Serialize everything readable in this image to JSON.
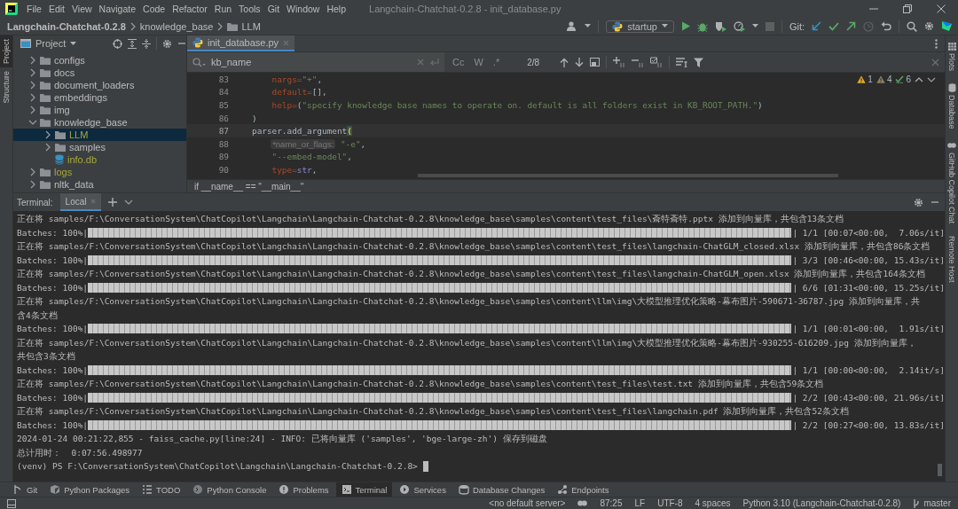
{
  "window": {
    "title": "Langchain-Chatchat-0.2.8 - init_database.py"
  },
  "menu": [
    "File",
    "Edit",
    "View",
    "Navigate",
    "Code",
    "Refactor",
    "Run",
    "Tools",
    "Git",
    "Window",
    "Help"
  ],
  "breadcrumb": [
    "Langchain-Chatchat-0.2.8",
    "knowledge_base",
    "LLM"
  ],
  "toolbar": {
    "run_config": "startup",
    "git_label": "Git:"
  },
  "left_stripe": [
    {
      "label": "Project",
      "selected": true
    },
    {
      "label": "Structure",
      "selected": false
    }
  ],
  "right_stripe": [
    "Plots",
    "Database",
    "GitHub Copilot Chat",
    "Remote Host"
  ],
  "project": {
    "title": "Project",
    "tree": [
      {
        "name": "configs",
        "kind": "folder",
        "expanded": false,
        "ignored": false,
        "selected": false
      },
      {
        "name": "docs",
        "kind": "folder",
        "expanded": false,
        "ignored": false,
        "selected": false
      },
      {
        "name": "document_loaders",
        "kind": "folder",
        "expanded": false,
        "ignored": false,
        "selected": false
      },
      {
        "name": "embeddings",
        "kind": "folder",
        "expanded": false,
        "ignored": false,
        "selected": false
      },
      {
        "name": "img",
        "kind": "folder",
        "expanded": false,
        "ignored": false,
        "selected": false
      },
      {
        "name": "knowledge_base",
        "kind": "folder",
        "expanded": true,
        "ignored": false,
        "selected": false,
        "children": [
          {
            "name": "LLM",
            "kind": "folder",
            "expanded": false,
            "ignored": true,
            "selected": true
          },
          {
            "name": "samples",
            "kind": "folder",
            "expanded": false,
            "ignored": false,
            "selected": false
          },
          {
            "name": "info.db",
            "kind": "database",
            "ignored": true,
            "selected": false
          }
        ]
      },
      {
        "name": "logs",
        "kind": "folder",
        "expanded": false,
        "ignored": true,
        "selected": false
      },
      {
        "name": "nltk_data",
        "kind": "folder",
        "expanded": false,
        "ignored": false,
        "selected": false
      }
    ]
  },
  "editor": {
    "tab": "init_database.py",
    "find": {
      "value": "kb_name",
      "options": [
        "Cc",
        "W",
        ".*"
      ],
      "count": "2/8"
    },
    "inspections": [
      {
        "kind": "error",
        "count": "1"
      },
      {
        "kind": "warning",
        "count": "4"
      },
      {
        "kind": "typo",
        "count": "6"
      }
    ],
    "lines": [
      {
        "number": "83",
        "current": false,
        "tokens": [
          {
            "text": "    nargs=",
            "kind": "param"
          },
          {
            "text": "\"+\"",
            "kind": "string"
          },
          {
            "text": ",",
            "kind": "plain"
          }
        ]
      },
      {
        "number": "84",
        "current": false,
        "tokens": [
          {
            "text": "    default=",
            "kind": "param"
          },
          {
            "text": "[],",
            "kind": "plain"
          }
        ]
      },
      {
        "number": "85",
        "current": false,
        "tokens": [
          {
            "text": "    help=",
            "kind": "param"
          },
          {
            "text": "(",
            "kind": "plain"
          },
          {
            "text": "\"specify knowledge base names to operate on. default is all folders exist in KB_ROOT_PATH.\"",
            "kind": "string"
          },
          {
            "text": ")",
            "kind": "plain"
          }
        ]
      },
      {
        "number": "86",
        "current": false,
        "tokens": [
          {
            "text": ")",
            "kind": "plain"
          }
        ]
      },
      {
        "number": "87",
        "current": true,
        "tokens": [
          {
            "text": "parser.add_argument",
            "kind": "plain"
          },
          {
            "text": "(",
            "kind": "bracket"
          }
        ]
      },
      {
        "number": "88",
        "current": false,
        "tokens": [
          {
            "text": "*name_or_flags:",
            "kind": "hint"
          },
          {
            "text": " \"-e\"",
            "kind": "string"
          },
          {
            "text": ",",
            "kind": "plain"
          }
        ]
      },
      {
        "number": "89",
        "current": false,
        "tokens": [
          {
            "text": "    \"--embed-model\"",
            "kind": "string"
          },
          {
            "text": ",",
            "kind": "plain"
          }
        ]
      },
      {
        "number": "90",
        "current": false,
        "tokens": [
          {
            "text": "    type=",
            "kind": "param"
          },
          {
            "text": "str",
            "kind": "builtin"
          },
          {
            "text": ",",
            "kind": "plain"
          }
        ]
      }
    ],
    "scope": "if __name__ == \"__main__\""
  },
  "terminal": {
    "label": "Terminal:",
    "tabs": [
      {
        "label": "Local",
        "selected": true
      }
    ],
    "lines": [
      {
        "kind": "text",
        "text": "正在将 samples/F:\\ConversationSystem\\ChatCopilot\\Langchain\\Langchain-Chatchat-0.2.8\\knowledge_base\\samples\\content\\test_files\\斊特斊特.pptx 添加到向量库，共包含13条文档"
      },
      {
        "kind": "progress",
        "label": "Batches: 100%|",
        "level": 1,
        "suffix": "| 1/1 [00:07<00:00,  7.06s/it]"
      },
      {
        "kind": "text",
        "text": "正在将 samples/F:\\ConversationSystem\\ChatCopilot\\Langchain\\Langchain-Chatchat-0.2.8\\knowledge_base\\samples\\content\\test_files\\langchain-ChatGLM_closed.xlsx 添加到向量库，共包含86条文档"
      },
      {
        "kind": "progress",
        "label": "Batches: 100%|",
        "level": 1,
        "suffix": "| 3/3 [00:46<00:00, 15.43s/it]"
      },
      {
        "kind": "text",
        "text": "正在将 samples/F:\\ConversationSystem\\ChatCopilot\\Langchain\\Langchain-Chatchat-0.2.8\\knowledge_base\\samples\\content\\test_files\\langchain-ChatGLM_open.xlsx 添加到向量库，共包含164条文档"
      },
      {
        "kind": "progress",
        "label": "Batches: 100%|",
        "level": 1,
        "suffix": "| 6/6 [01:31<00:00, 15.25s/it]"
      },
      {
        "kind": "text",
        "text": "正在将 samples/F:\\ConversationSystem\\ChatCopilot\\Langchain\\Langchain-Chatchat-0.2.8\\knowledge_base\\samples\\content\\llm\\img\\大模型推理优化策略-幕布图片-590671-36787.jpg 添加到向量库，共"
      },
      {
        "kind": "text",
        "text": "含4条文档"
      },
      {
        "kind": "progress",
        "label": "Batches: 100%|",
        "level": 1,
        "suffix": "| 1/1 [00:01<00:00,  1.91s/it]"
      },
      {
        "kind": "text",
        "text": "正在将 samples/F:\\ConversationSystem\\ChatCopilot\\Langchain\\Langchain-Chatchat-0.2.8\\knowledge_base\\samples\\content\\llm\\img\\大模型推理优化策略-幕布图片-930255-616209.jpg 添加到向量库，"
      },
      {
        "kind": "text",
        "text": "共包含3条文档"
      },
      {
        "kind": "progress",
        "label": "Batches: 100%|",
        "level": 1,
        "suffix": "| 1/1 [00:00<00:00,  2.14it/s]"
      },
      {
        "kind": "text",
        "text": "正在将 samples/F:\\ConversationSystem\\ChatCopilot\\Langchain\\Langchain-Chatchat-0.2.8\\knowledge_base\\samples\\content\\test_files\\test.txt 添加到向量库，共包含59条文档"
      },
      {
        "kind": "progress",
        "label": "Batches: 100%|",
        "level": 1,
        "suffix": "| 2/2 [00:43<00:00, 21.96s/it]"
      },
      {
        "kind": "text",
        "text": "正在将 samples/F:\\ConversationSystem\\ChatCopilot\\Langchain\\Langchain-Chatchat-0.2.8\\knowledge_base\\samples\\content\\test_files\\langchain.pdf 添加到向量库，共包含52条文档"
      },
      {
        "kind": "progress",
        "label": "Batches: 100%|",
        "level": 1,
        "suffix": "| 2/2 [00:27<00:00, 13.83s/it]"
      },
      {
        "kind": "text",
        "text": "2024-01-24 00:21:22,855 - faiss_cache.py[line:24] - INFO: 已将向量库 ('samples', 'bge-large-zh') 保存到磁盘"
      },
      {
        "kind": "text",
        "text": "总计用时：  0:07:56.498977"
      },
      {
        "kind": "prompt",
        "text": "(venv) PS F:\\ConversationSystem\\ChatCopilot\\Langchain\\Langchain-Chatchat-0.2.8> "
      }
    ]
  },
  "tool_tabs": [
    {
      "label": "Git",
      "selected": false
    },
    {
      "label": "Python Packages",
      "selected": false
    },
    {
      "label": "TODO",
      "selected": false
    },
    {
      "label": "Python Console",
      "selected": false
    },
    {
      "label": "Problems",
      "selected": false
    },
    {
      "label": "Terminal",
      "selected": true
    },
    {
      "label": "Services",
      "selected": false
    },
    {
      "label": "Database Changes",
      "selected": false
    },
    {
      "label": "Endpoints",
      "selected": false
    }
  ],
  "status_bar": {
    "server": "<no default server>",
    "position": "87:25",
    "line_ending": "LF",
    "encoding": "UTF-8",
    "indent": "4 spaces",
    "interpreter": "Python 3.10 (Langchain-Chatchat-0.2.8)",
    "branch": "master"
  }
}
